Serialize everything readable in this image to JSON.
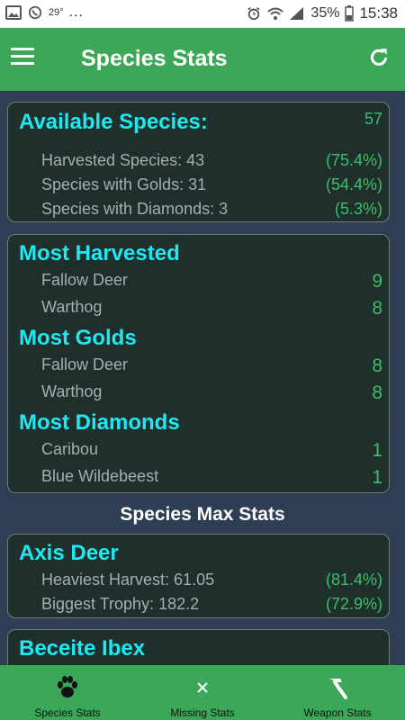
{
  "status_bar": {
    "temperature": "29°",
    "dots": "...",
    "battery": "35%",
    "time": "15:38"
  },
  "app_bar": {
    "title": "Species Stats"
  },
  "available": {
    "title": "Available Species:",
    "total": "57",
    "rows": [
      {
        "label": "Harvested Species: 43",
        "value": "(75.4%)"
      },
      {
        "label": "Species with Golds: 31",
        "value": "(54.4%)"
      },
      {
        "label": "Species with Diamonds: 3",
        "value": "(5.3%)"
      }
    ]
  },
  "tops": {
    "most_harvested": {
      "title": "Most Harvested",
      "rows": [
        {
          "label": "Fallow Deer",
          "value": "9"
        },
        {
          "label": "Warthog",
          "value": "8"
        }
      ]
    },
    "most_golds": {
      "title": "Most Golds",
      "rows": [
        {
          "label": "Fallow Deer",
          "value": "8"
        },
        {
          "label": "Warthog",
          "value": "8"
        }
      ]
    },
    "most_diamonds": {
      "title": "Most Diamonds",
      "rows": [
        {
          "label": "Caribou",
          "value": "1"
        },
        {
          "label": "Blue Wildebeest",
          "value": "1"
        }
      ]
    }
  },
  "max_stats": {
    "section_title": "Species Max Stats",
    "species": [
      {
        "name": "Axis Deer",
        "rows": [
          {
            "label": "Heaviest Harvest: 61.05",
            "value": "(81.4%)"
          },
          {
            "label": "Biggest Trophy: 182.2",
            "value": "(72.9%)"
          }
        ]
      },
      {
        "name": "Beceite Ibex"
      }
    ]
  },
  "bottom_nav": {
    "items": [
      {
        "label": "Species Stats",
        "icon": "paw-icon"
      },
      {
        "label": "Missing Stats",
        "icon": "close-icon"
      },
      {
        "label": "Weapon Stats",
        "icon": "hammer-icon"
      }
    ]
  }
}
